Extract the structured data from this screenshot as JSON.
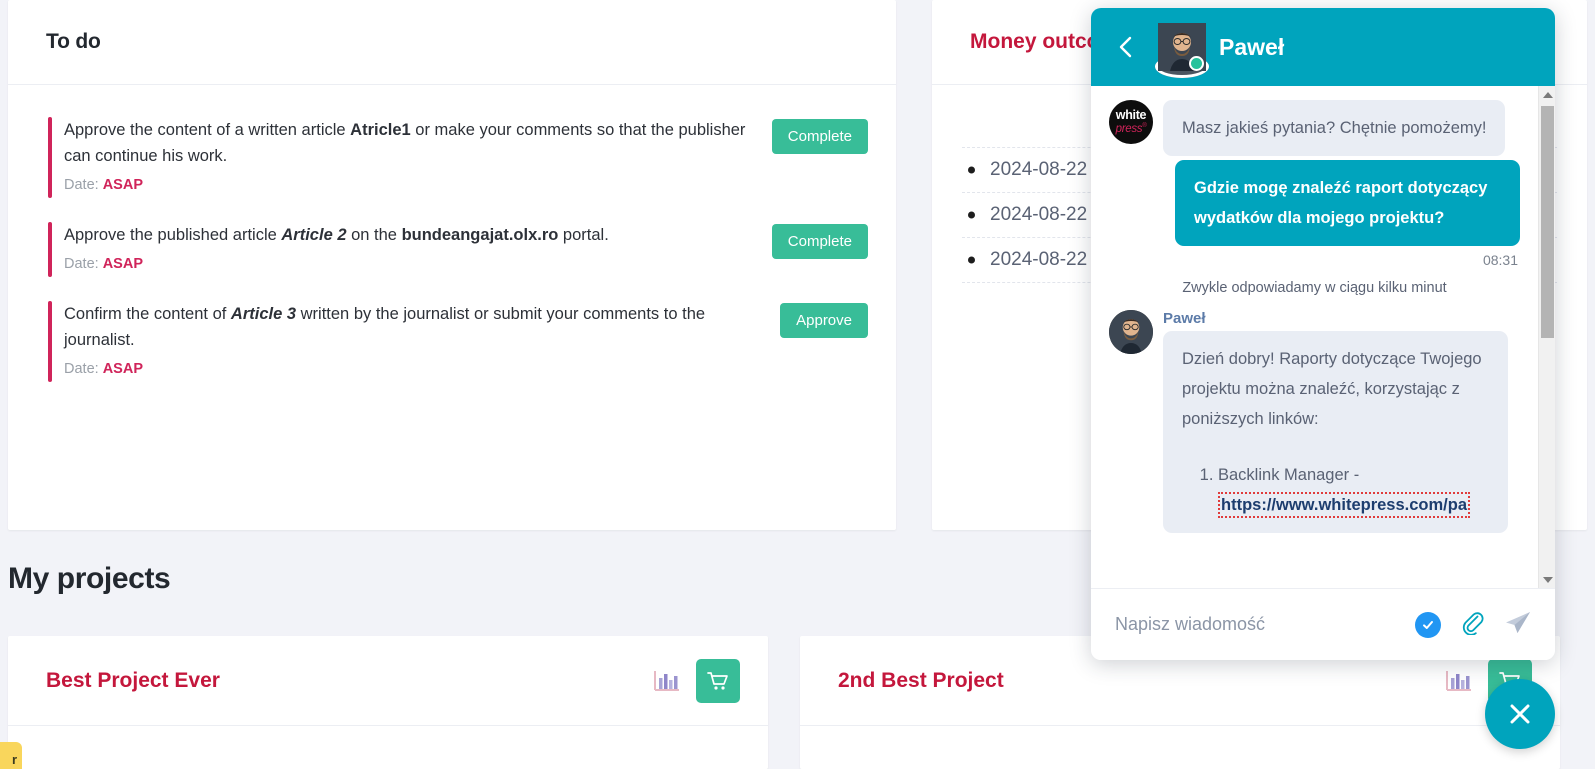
{
  "todo": {
    "title": "To do",
    "items": [
      {
        "prefix": "Approve the content of a written article ",
        "strong": "Atricle1",
        "suffix": " or make your comments so that the publisher can continue his work.",
        "date_label": "Date:",
        "date_value": "ASAP",
        "action": "Complete"
      },
      {
        "prefix": "Approve the published article ",
        "emph": "Article 2",
        "mid": " on the ",
        "strong": "bundeangajat.olx.ro",
        "suffix": " portal.",
        "date_label": "Date:",
        "date_value": "ASAP",
        "action": "Complete"
      },
      {
        "prefix": "Confirm the content of ",
        "emph": "Article 3",
        "suffix": " written by the journalist or submit your comments to the journalist.",
        "date_label": "Date:",
        "date_value": "ASAP",
        "action": "Approve"
      }
    ]
  },
  "money": {
    "title": "Money outcome",
    "rows": [
      "2024-08-22",
      "2024-08-22",
      "2024-08-22"
    ]
  },
  "projects": {
    "heading": "My projects",
    "cards": [
      {
        "title": "Best Project Ever",
        "stats_icon": "bar-chart-icon",
        "cart_icon": "shopping-cart-icon"
      },
      {
        "title": "2nd Best Project",
        "stats_icon": "bar-chart-icon",
        "cart_icon": "shopping-cart-icon"
      }
    ]
  },
  "badge": {
    "text": "r"
  },
  "chat": {
    "header": {
      "back_icon": "chevron-left-icon",
      "agent_name": "Paweł",
      "status": "online"
    },
    "brand_logo": {
      "line1": "white",
      "line2": "press",
      "mark": "®"
    },
    "messages": [
      {
        "type": "incoming",
        "text": "Masz jakieś pytania? Chętnie pomożemy!"
      },
      {
        "type": "outgoing",
        "text": "Gdzie mogę znaleźć raport dotyczący wydatków dla mojego projektu?",
        "time": "08:31"
      }
    ],
    "typing_note": "Zwykle odpowiadamy w ciągu kilku minut",
    "reply": {
      "sender": "Paweł",
      "text": "Dzień dobry! Raporty dotyczące Twojego projektu można znaleźć, korzystając z poniższych linków:",
      "list_item_1": "Backlink Manager - ",
      "list_link_1": "https://www.whitepress.com/pa"
    },
    "input": {
      "placeholder": "Napisz wiadomość",
      "check_icon": "check-circle-icon",
      "attach_icon": "paperclip-icon",
      "send_icon": "send-icon"
    },
    "close_icon": "close-icon"
  },
  "colors": {
    "teal": "#00a4bd",
    "green": "#38bd98",
    "crimson": "#c4173c",
    "pink": "#d0245a",
    "page_bg": "#f2f3f8"
  }
}
